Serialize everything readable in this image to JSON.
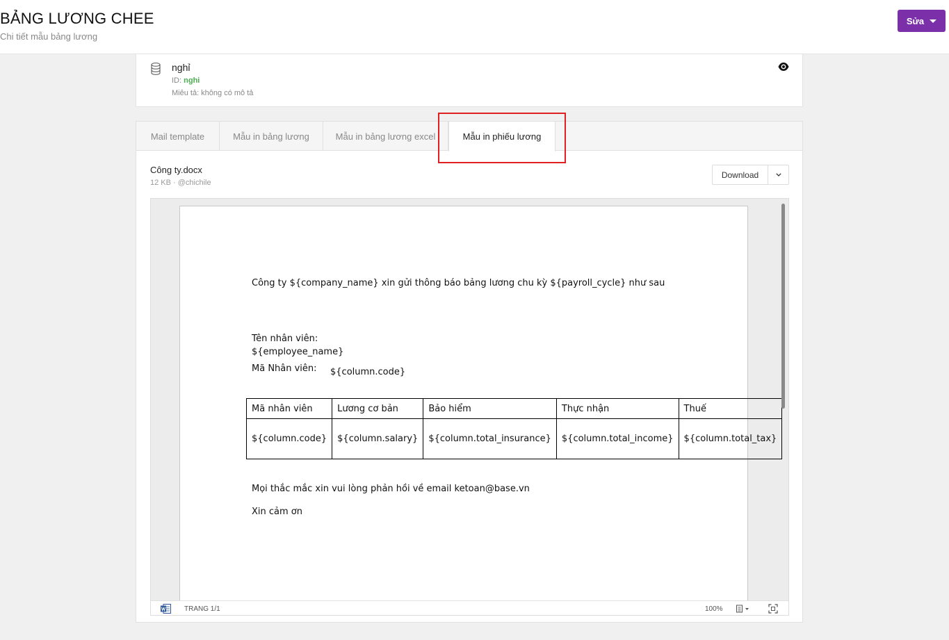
{
  "header": {
    "title": "BẢNG LƯƠNG CHEE",
    "subtitle": "Chi tiết mẫu bảng lương",
    "edit_label": "Sửa"
  },
  "info": {
    "icon": "database-icon",
    "name": "nghỉ",
    "id_label": "ID:",
    "id_value": "nghi",
    "description": "Miêu tả: không có mô tả"
  },
  "tabs": [
    {
      "label": "Mail template",
      "active": false
    },
    {
      "label": "Mẫu in bảng lương",
      "active": false
    },
    {
      "label": "Mẫu in bảng lương excel",
      "active": false
    },
    {
      "label": "Mẫu in phiếu lương",
      "active": true
    }
  ],
  "file": {
    "name": "Công ty.docx",
    "meta": "12 KB · @chichile",
    "download_label": "Download"
  },
  "document": {
    "intro": "Công ty ${company_name} xin gửi thông báo bảng lương chu kỳ ${payroll_cycle}  như sau",
    "employee_name_label": "Tên nhân viên:",
    "employee_name_value": "${employee_name}",
    "employee_code_label": "Mã Nhân viên:",
    "employee_code_value": "${column.code}",
    "table": {
      "headers": [
        "Mã nhân viên",
        "Lương cơ bản",
        "Bảo hiểm",
        "Thực nhận",
        "Thuế"
      ],
      "row": [
        "${column.code}",
        "${column.salary}",
        "${column.total_insurance}",
        "${column.total_income}",
        "${column.total_tax}"
      ]
    },
    "contact_line": "Mọi thắc mắc xin vui lòng phản hồi về email ketoan@base.vn",
    "closing": "Xin cảm ơn"
  },
  "viewer": {
    "page_indicator": "TRANG 1/1",
    "zoom": "100%"
  },
  "colors": {
    "accent": "#7b2fa8",
    "id_green": "#4caf50",
    "highlight_red": "#e02020"
  }
}
